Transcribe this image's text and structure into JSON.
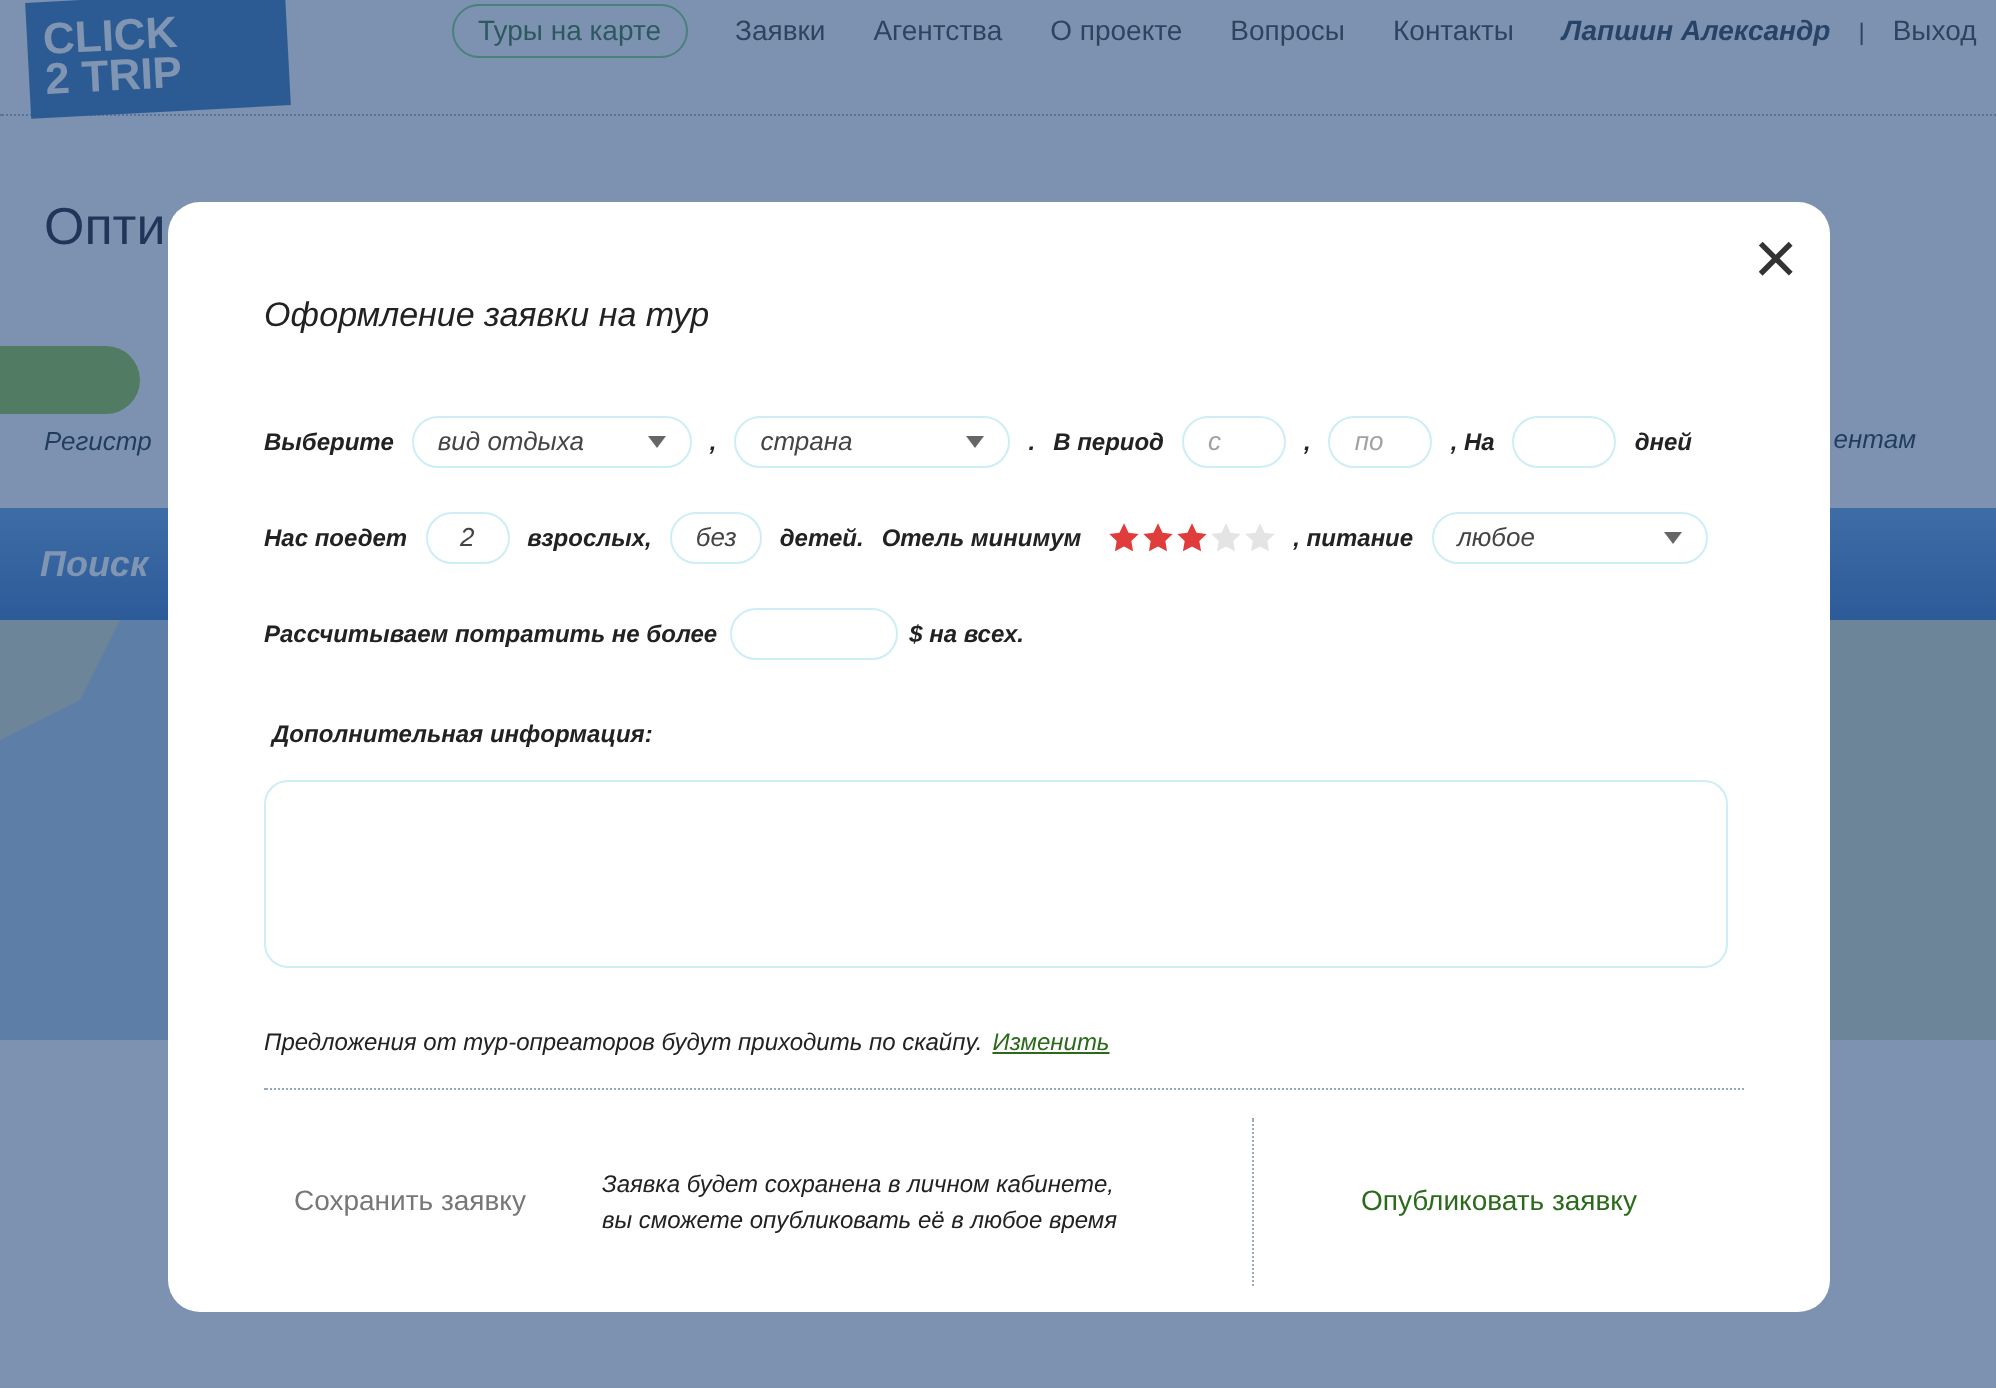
{
  "header": {
    "logo": {
      "line_1": "CLICK",
      "line_2": "2 TRIP"
    },
    "nav": [
      {
        "label": "Туры на карте",
        "selected": true
      },
      {
        "label": "Заявки",
        "selected": false
      },
      {
        "label": "Агентства",
        "selected": false
      },
      {
        "label": "О проекте",
        "selected": false
      },
      {
        "label": "Вопросы",
        "selected": false
      },
      {
        "label": "Контакты",
        "selected": false
      }
    ],
    "user": "Лапшин Александр",
    "separator": "|",
    "logout": "Выход"
  },
  "background": {
    "heading": "Опти",
    "right_fragments": [
      "ентам"
    ],
    "promo_caption": "Регистр",
    "search_bar": "Поиск"
  },
  "modal": {
    "title": "Оформление заявки на тур",
    "close": "×",
    "row_1": {
      "label_choose": "Выберите",
      "type_select": "вид отдыха",
      "comma_1": ",",
      "country_select": "страна",
      "dot": ".",
      "label_period": "В период",
      "from": {
        "placeholder": "с"
      },
      "comma_2": ",",
      "to": {
        "placeholder": "по"
      },
      "comma_3": ", На",
      "label_days": "дней"
    },
    "row_2": {
      "label_going": "Нас поедет",
      "adults": {
        "value": "2"
      },
      "label_adults": "взрослых,",
      "children": {
        "placeholder": "без"
      },
      "label_children": "детей.",
      "label_hotel": "Отель минимум",
      "stars": 3,
      "label_food": ", питание",
      "food_select": "любое"
    },
    "row_3": {
      "label_budget": "Рассчитываем потратить не более",
      "label_currency": "$ на всех."
    },
    "info_label": "Дополнительная информация:",
    "notice": "Предложения от тур-опреаторов будут приходить по скайпу.",
    "notice_link": "Изменить",
    "save_button": "Сохранить заявку",
    "save_hint_1": "Заявка будет сохранена в личном кабинете,",
    "save_hint_2": "вы сможете опубликовать её в любое время",
    "publish_button": "Опубликовать заявку"
  }
}
